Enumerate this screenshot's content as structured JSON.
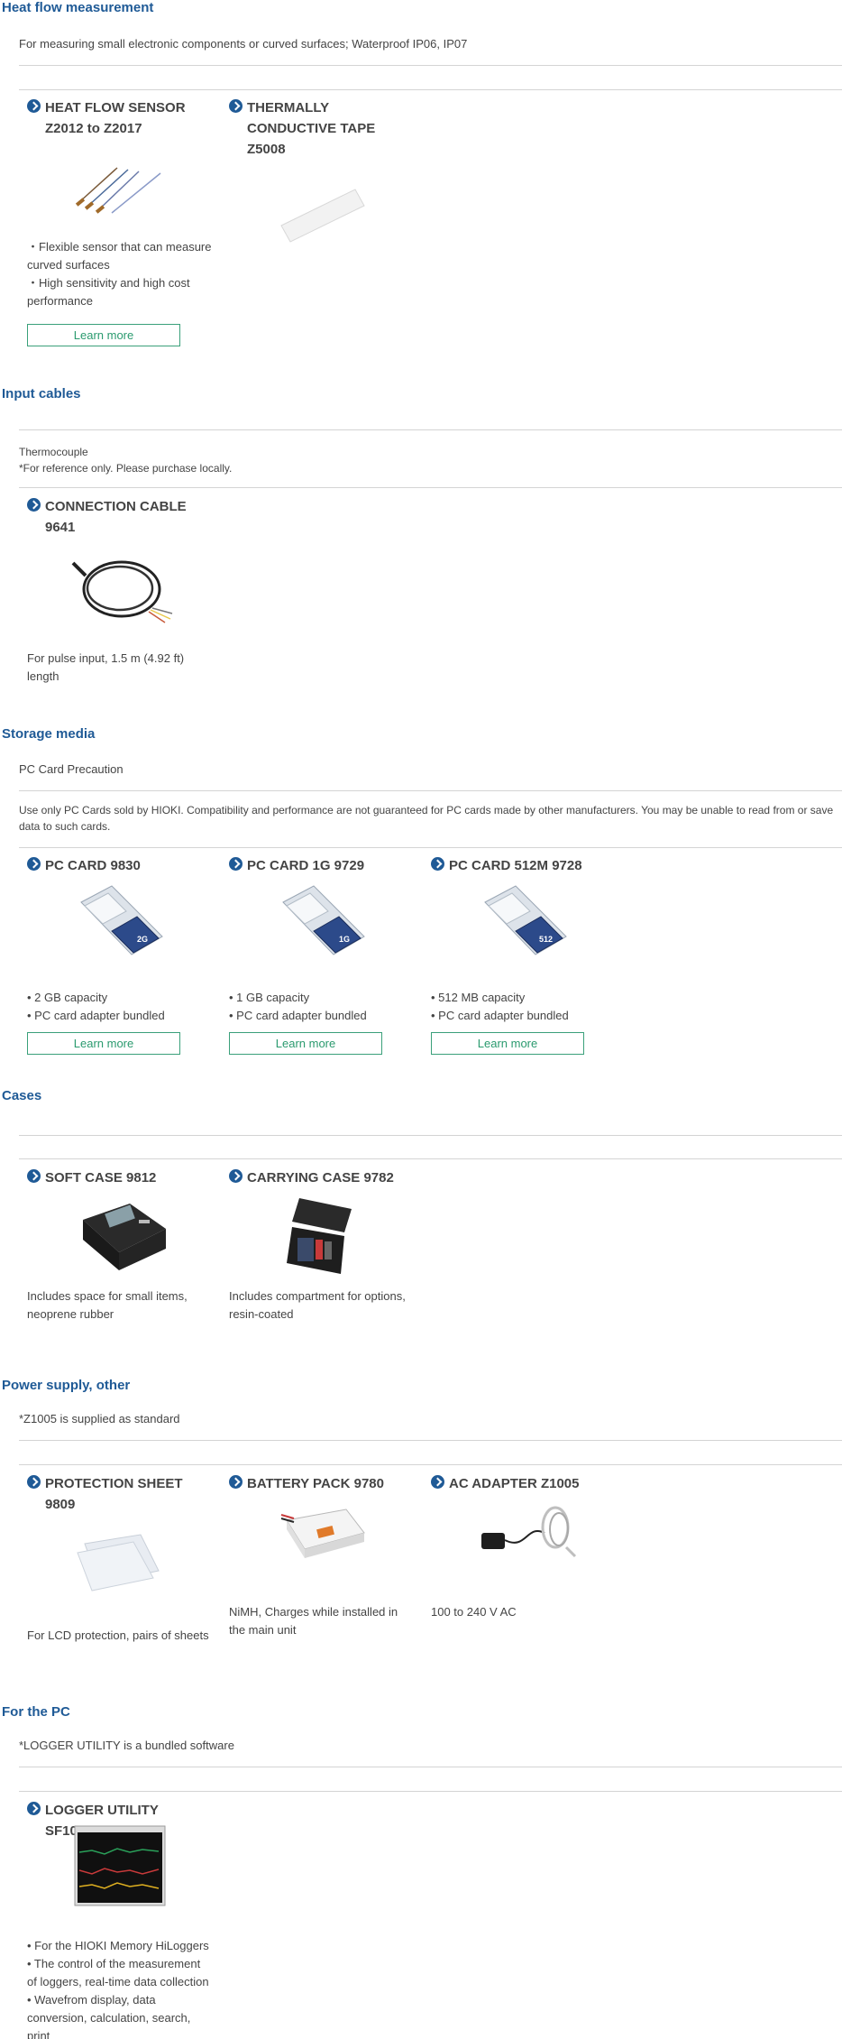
{
  "heat_flow": {
    "title": "Heat flow measurement",
    "intro": "For measuring small electronic components or curved surfaces; Waterproof IP06, IP07",
    "cards": [
      {
        "title_lines": [
          "HEAT FLOW SENSOR",
          "Z2012 to Z2017"
        ],
        "desc_lines": [
          "・Flexible sensor that can measure curved surfaces",
          "・High sensitivity and high cost performance"
        ],
        "button": "Learn more"
      },
      {
        "title_lines": [
          "THERMALLY",
          "CONDUCTIVE TAPE",
          "Z5008"
        ]
      }
    ]
  },
  "input_cables": {
    "title": "Input cables",
    "intro_line1": "Thermocouple",
    "intro_line2": "*For reference only. Please purchase locally.",
    "cards": [
      {
        "title_lines": [
          "CONNECTION CABLE",
          "9641"
        ],
        "desc_lines": [
          "For pulse input, 1.5 m (4.92 ft) length"
        ]
      }
    ]
  },
  "storage_media": {
    "title": "Storage media",
    "intro": "PC Card Precaution",
    "note": "Use only PC Cards sold by HIOKI. Compatibility and performance are not guaranteed for PC cards made by other manufacturers. You may be unable to read from or save data to such cards.",
    "cards": [
      {
        "title_lines": [
          "PC CARD 9830"
        ],
        "card_label": "2G",
        "desc_lines": [
          "• 2 GB capacity",
          "• PC card adapter bundled"
        ],
        "button": "Learn more"
      },
      {
        "title_lines": [
          "PC CARD 1G 9729"
        ],
        "card_label": "1G",
        "desc_lines": [
          "• 1 GB capacity",
          "• PC card adapter bundled"
        ],
        "button": "Learn more"
      },
      {
        "title_lines": [
          "PC CARD 512M 9728"
        ],
        "card_label": "512",
        "desc_lines": [
          "• 512 MB capacity",
          "• PC card adapter bundled"
        ],
        "button": "Learn more"
      }
    ]
  },
  "cases": {
    "title": "Cases",
    "cards": [
      {
        "title_lines": [
          "SOFT CASE 9812"
        ],
        "desc_lines": [
          "Includes space for small items, neoprene rubber"
        ]
      },
      {
        "title_lines": [
          "CARRYING CASE 9782"
        ],
        "desc_lines": [
          "Includes compartment for options, resin-coated"
        ]
      }
    ]
  },
  "power_supply": {
    "title": "Power supply, other",
    "intro": "*Z1005 is supplied as standard",
    "cards": [
      {
        "title_lines": [
          "PROTECTION SHEET",
          "9809"
        ],
        "desc_lines": [
          "For LCD protection, pairs of sheets"
        ]
      },
      {
        "title_lines": [
          "BATTERY PACK 9780"
        ],
        "desc_lines": [
          "NiMH, Charges while installed in the main unit"
        ]
      },
      {
        "title_lines": [
          "AC ADAPTER Z1005"
        ],
        "desc_lines": [
          "100 to 240 V AC"
        ]
      }
    ]
  },
  "for_pc": {
    "title": "For the PC",
    "intro": "*LOGGER UTILITY is a bundled software",
    "cards": [
      {
        "title_lines": [
          "LOGGER UTILITY SF1000"
        ],
        "desc_lines": [
          "• For the HIOKI Memory HiLoggers",
          "• The control of the measurement of loggers, real-time data collection",
          "• Wavefrom display, data conversion, calculation, search, print"
        ]
      }
    ]
  },
  "colors": {
    "heading": "#1f5a96",
    "button_border": "#3aa07a",
    "button_text": "#2a9a6e",
    "divider": "#d4d4d4"
  }
}
